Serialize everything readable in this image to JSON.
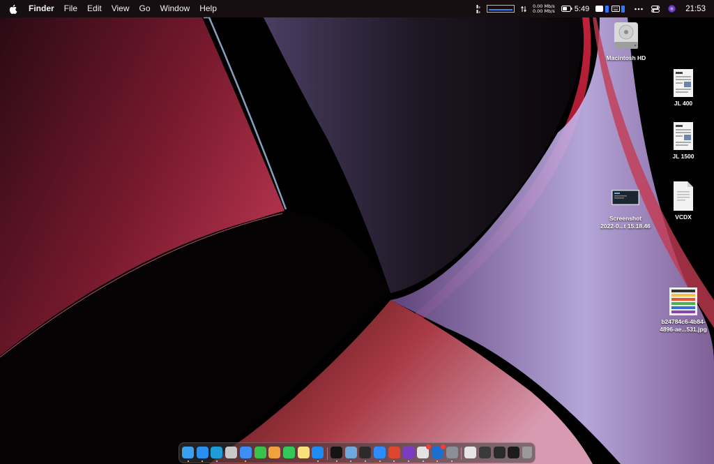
{
  "menubar": {
    "app_name": "Finder",
    "menus": [
      "File",
      "Edit",
      "View",
      "Go",
      "Window",
      "Help"
    ],
    "network": {
      "up": "0.00 Mb/s",
      "down": "0.00 Mb/s"
    },
    "battery_time": "5:49",
    "clock": "21:53"
  },
  "desktop_icons": [
    {
      "label_lines": [
        "Macintosh HD"
      ],
      "icon": "hard-drive-icon"
    },
    {
      "label_lines": [
        "JL 400"
      ],
      "icon": "document-thumbnail-icon"
    },
    {
      "label_lines": [
        "JL 1500"
      ],
      "icon": "document-thumbnail-icon"
    },
    {
      "label_lines": [
        "Screenshot",
        "2022-0...t 15.18.46"
      ],
      "icon": "screenshot-thumbnail-icon"
    },
    {
      "label_lines": [
        "VCDX"
      ],
      "icon": "blank-document-icon"
    },
    {
      "label_lines": [
        "b24784c6-4b84-",
        "4896-ae...531.jpg"
      ],
      "icon": "image-thumbnail-icon"
    }
  ],
  "dock": {
    "apps": [
      {
        "name": "finder",
        "color": "#3aa0f0",
        "running": true
      },
      {
        "name": "safari",
        "color": "#2b8ff0",
        "running": true
      },
      {
        "name": "edge",
        "color": "#1f9bd8",
        "running": true
      },
      {
        "name": "launchpad",
        "color": "#c8c8c8",
        "running": false
      },
      {
        "name": "mail",
        "color": "#3c8ef2",
        "running": true
      },
      {
        "name": "messages",
        "color": "#39c34b",
        "running": false
      },
      {
        "name": "photos",
        "color": "#f2a23c",
        "running": false
      },
      {
        "name": "facetime",
        "color": "#34c759",
        "running": false
      },
      {
        "name": "notes",
        "color": "#f7e17a",
        "running": false
      },
      {
        "name": "app-store",
        "color": "#1e8cf5",
        "running": true
      },
      {
        "name": "prompt",
        "color": "#141414",
        "running": true
      },
      {
        "name": "maps",
        "color": "#6fa8dc",
        "running": true
      },
      {
        "name": "terminal",
        "color": "#2b2b2b",
        "running": true
      },
      {
        "name": "zoom",
        "color": "#2d8cff",
        "running": true
      },
      {
        "name": "sketch",
        "color": "#e0462f",
        "running": true
      },
      {
        "name": "onenote",
        "color": "#7b3cc1",
        "running": true
      },
      {
        "name": "slack",
        "color": "#e2e2e2",
        "running": true,
        "badge": true
      },
      {
        "name": "outlook",
        "color": "#1a6fd1",
        "running": true,
        "badge": true
      },
      {
        "name": "system-info",
        "color": "#8a8f98",
        "running": true
      }
    ],
    "recents": [
      {
        "name": "document",
        "color": "#e6e6e6"
      },
      {
        "name": "screenshot-folder",
        "color": "#3a3a3a"
      },
      {
        "name": "downloads-stack",
        "color": "#2a2a2a"
      },
      {
        "name": "window-thumbnail",
        "color": "#1c1c1c"
      },
      {
        "name": "trash",
        "color": "#9a9a9a"
      }
    ]
  }
}
